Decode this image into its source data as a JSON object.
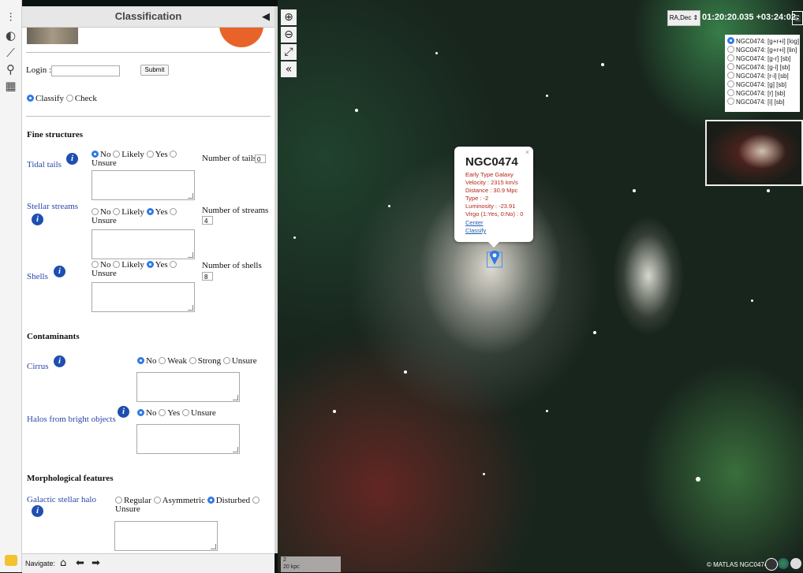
{
  "panel": {
    "title": "Classification",
    "collapse_icon": "triangle-left-icon",
    "login_label": "Login :",
    "login_value": "",
    "submit_label": "Submit",
    "mode": {
      "options": [
        "Classify",
        "Check"
      ],
      "selected": "Classify"
    }
  },
  "fine_structures": {
    "heading": "Fine structures",
    "tidal_tails": {
      "label": "Tidal tails",
      "options": [
        "No",
        "Likely",
        "Yes",
        "Unsure"
      ],
      "selected": "No",
      "count_label": "Number of tails",
      "count": "0"
    },
    "stellar_streams": {
      "label": "Stellar streams",
      "options": [
        "No",
        "Likely",
        "Yes",
        "Unsure"
      ],
      "selected": "Yes",
      "count_label": "Number of streams",
      "count": "4"
    },
    "shells": {
      "label": "Shells",
      "options": [
        "No",
        "Likely",
        "Yes",
        "Unsure"
      ],
      "selected": "Yes",
      "count_label": "Number of shells",
      "count": "8"
    }
  },
  "contaminants": {
    "heading": "Contaminants",
    "cirrus": {
      "label": "Cirrus",
      "options": [
        "No",
        "Weak",
        "Strong",
        "Unsure"
      ],
      "selected": "No"
    },
    "halos": {
      "label": "Halos from bright objects",
      "options": [
        "No",
        "Yes",
        "Unsure"
      ],
      "selected": "No"
    }
  },
  "morphology": {
    "heading": "Morphological features",
    "galactic_halo": {
      "label": "Galactic stellar halo",
      "options": [
        "Regular",
        "Asymmetric",
        "Disturbed",
        "Unsure"
      ],
      "selected": "Disturbed"
    }
  },
  "nav": {
    "label": "Navigate:",
    "home_icon": "home-icon",
    "prev_icon": "arrow-left-icon",
    "next_icon": "arrow-right-icon"
  },
  "map": {
    "coord_system": "RA,Dec ⇕",
    "coordinates": "01:20:20.035 +03:24:02.",
    "layers": [
      {
        "label": "NGC0474: [g+r+i] [log]",
        "selected": true
      },
      {
        "label": "NGC0474: [g+r+i] [lin]",
        "selected": false
      },
      {
        "label": "NGC0474: [g-r] [sb]",
        "selected": false
      },
      {
        "label": "NGC0474: [g-i] [sb]",
        "selected": false
      },
      {
        "label": "NGC0474: [r-i] [sb]",
        "selected": false
      },
      {
        "label": "NGC0474: [g] [sb]",
        "selected": false
      },
      {
        "label": "NGC0474: [r] [sb]",
        "selected": false
      },
      {
        "label": "NGC0474: [i] [sb]",
        "selected": false
      }
    ],
    "popup": {
      "name": "NGC0474",
      "type_text": "Early Type Galaxy",
      "velocity": "Velocity : 2315 km/s",
      "distance": "Distance : 30.9 Mpc",
      "type": "Type : -2",
      "luminosity": "Luminosity : -23.91",
      "virgo": "Virgo (1:Yes, 0:No) : 0",
      "center_link": "Center",
      "classify_link": "Classify",
      "close": "×"
    },
    "scale_top": "2",
    "scale_bottom": "20 kpc",
    "credit": "© MATLAS NGC0474"
  },
  "colors": {
    "accent": "#2f7ae5",
    "label_blue": "#2c46a8",
    "info_blue": "#1e4fb0",
    "popup_red": "#b3241b",
    "orange": "#e8632a"
  }
}
